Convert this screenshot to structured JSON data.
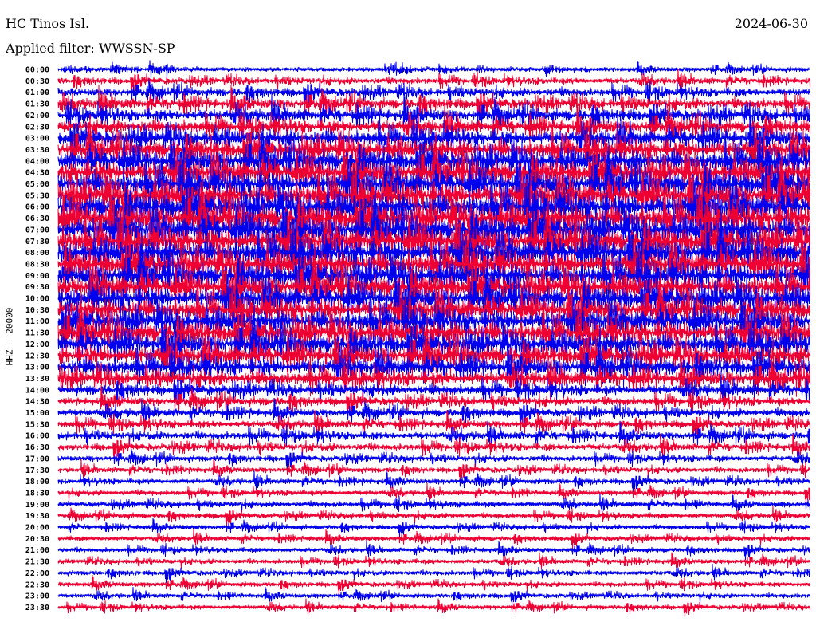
{
  "header": {
    "station": "HC Tinos Isl.",
    "date": "2024-06-30",
    "filter": "Applied filter: WWSSN-SP"
  },
  "chart_data": {
    "type": "line",
    "title": "HC Tinos Isl.",
    "date": "2024-06-30",
    "filter": "WWSSN-SP",
    "ylabel": "HHZ - 20000",
    "row_interval_minutes": 30,
    "row_labels": [
      "00:00",
      "00:30",
      "01:00",
      "01:30",
      "02:00",
      "02:30",
      "03:00",
      "03:30",
      "04:00",
      "04:30",
      "05:00",
      "05:30",
      "06:00",
      "06:30",
      "07:00",
      "07:30",
      "08:00",
      "08:30",
      "09:00",
      "09:30",
      "10:00",
      "10:30",
      "11:00",
      "11:30",
      "12:00",
      "12:30",
      "13:00",
      "13:30",
      "14:00",
      "14:30",
      "15:00",
      "15:30",
      "16:00",
      "16:30",
      "17:00",
      "17:30",
      "18:00",
      "18:30",
      "19:00",
      "19:30",
      "20:00",
      "20:30",
      "21:00",
      "21:30",
      "22:00",
      "22:30",
      "23:00",
      "23:30"
    ],
    "series_colors": [
      "#0000ee",
      "#ee0033"
    ],
    "relative_amplitude": [
      0.25,
      0.35,
      0.45,
      0.55,
      0.62,
      0.68,
      0.8,
      0.95,
      1.05,
      1.1,
      1.15,
      1.2,
      1.25,
      1.25,
      1.2,
      1.2,
      1.2,
      1.15,
      1.1,
      1.1,
      1.05,
      1.0,
      1.05,
      1.05,
      1.0,
      0.95,
      0.85,
      0.75,
      0.55,
      0.45,
      0.42,
      0.4,
      0.42,
      0.38,
      0.32,
      0.3,
      0.3,
      0.28,
      0.3,
      0.28,
      0.26,
      0.26,
      0.26,
      0.26,
      0.26,
      0.26,
      0.25,
      0.25
    ]
  }
}
